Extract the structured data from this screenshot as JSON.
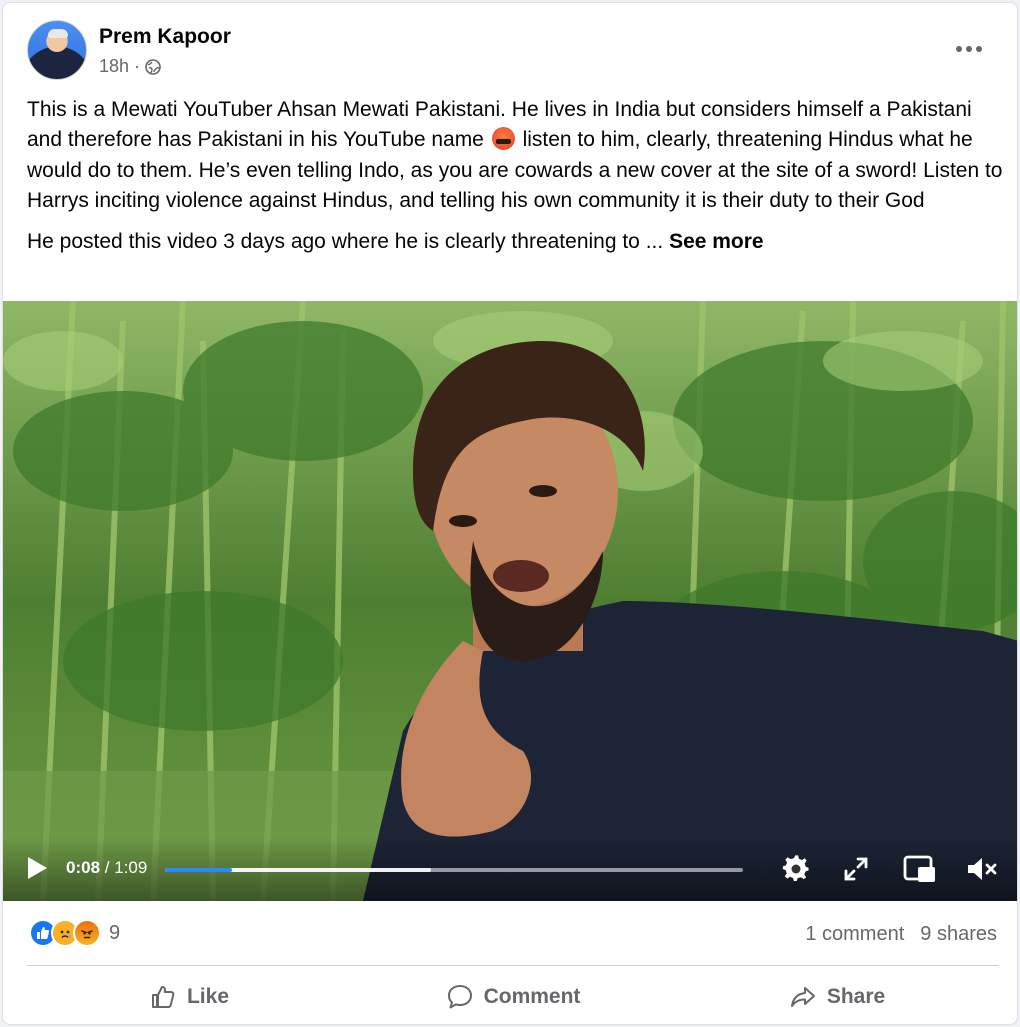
{
  "post": {
    "author": "Prem Kapoor",
    "time": "18h",
    "separator": "·",
    "privacy_icon": "globe-icon",
    "text_p1_a": "This is a Mewati YouTuber Ahsan Mewati Pakistani. He  lives in India but considers himself a Pakistani and therefore has Pakistani in his YouTube name",
    "text_p1_b": "listen to him, clearly, threatening Hindus what he would do to them. He’s even telling Indo, as you are cowards a new cover at the site of a sword! Listen to Harrys inciting violence against Hindus, and telling his own community it is their duty to their God",
    "text_p2": "He posted this video 3 days ago where he is clearly threatening to ...",
    "see_more": "See more"
  },
  "video": {
    "current_time": "0:08",
    "duration": "/ 1:09",
    "played_fraction": 0.116,
    "buffered_fraction": 0.46,
    "icons": [
      "play-icon",
      "settings-icon",
      "fullscreen-icon",
      "pip-icon",
      "mute-icon"
    ]
  },
  "stats": {
    "reaction_count": "9",
    "reactions": [
      "like",
      "sad",
      "angry"
    ],
    "comments": "1 comment",
    "shares": "9 shares"
  },
  "actions": {
    "like": "Like",
    "comment": "Comment",
    "share": "Share"
  },
  "colors": {
    "accent": "#1877f2",
    "secondary_text": "#65676b",
    "progress": "#2d88ff"
  }
}
